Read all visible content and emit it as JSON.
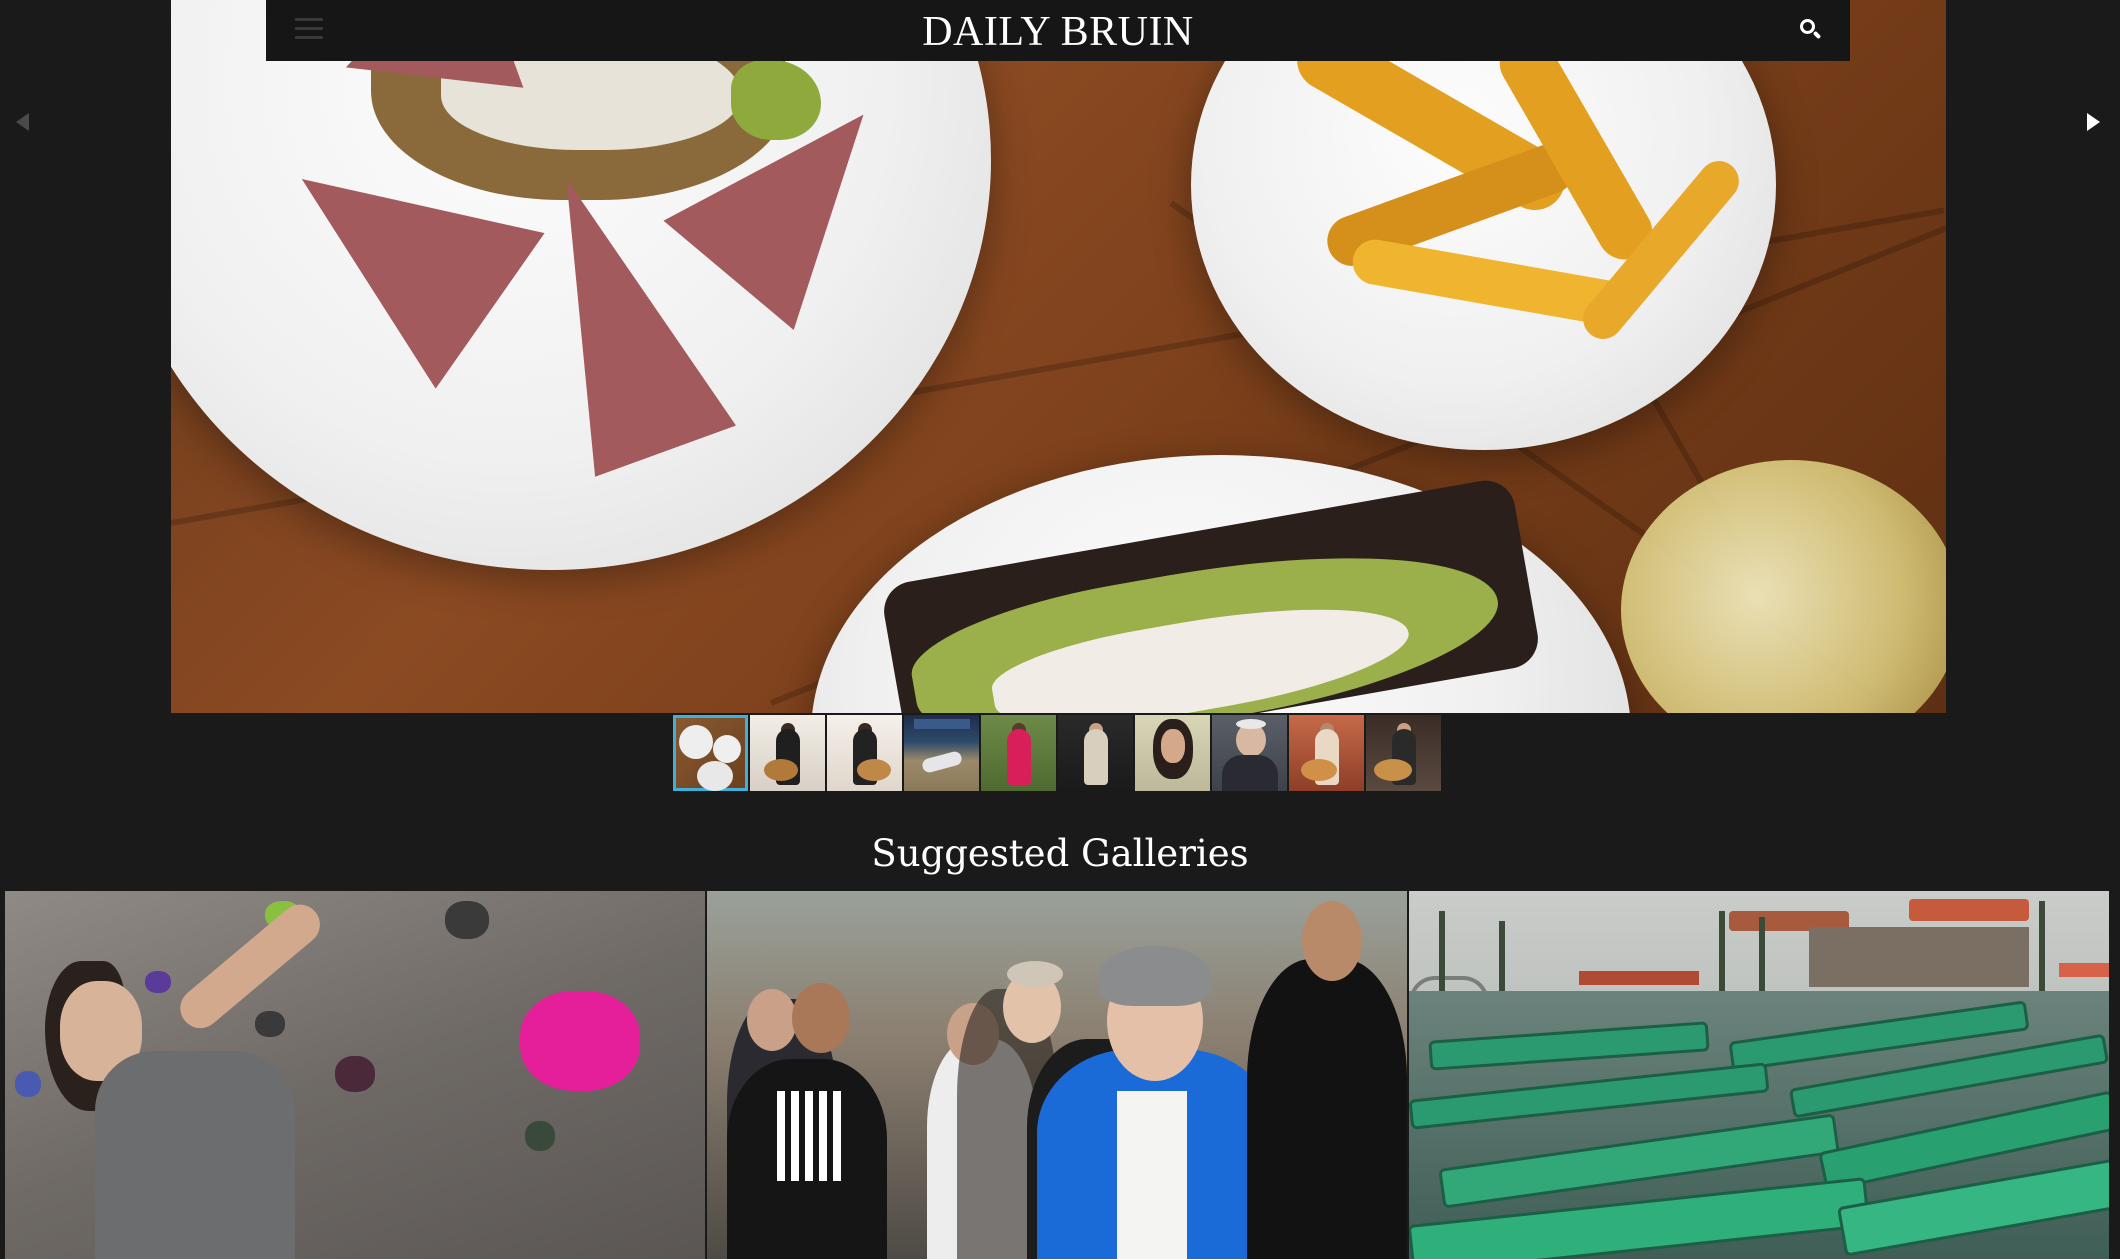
{
  "header": {
    "logo_text": "DAILY BRUIN",
    "menu_icon": "hamburger-menu-icon",
    "search_icon": "search-icon"
  },
  "slideshow": {
    "prev_icon": "chevron-left-icon",
    "next_icon": "chevron-right-icon",
    "thumbnail_count": 10,
    "active_thumbnail": 1
  },
  "suggested": {
    "title": "Suggested Galleries"
  },
  "colors": {
    "background": "#1a1a1a",
    "header_bar": "#161616",
    "active_thumbnail_border": "#3fb0d8",
    "text": "#ffffff"
  }
}
